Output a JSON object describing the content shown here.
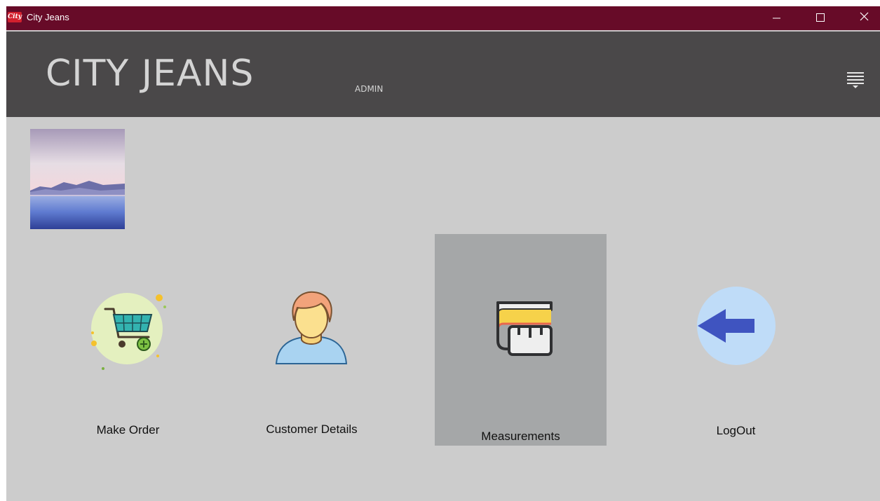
{
  "window": {
    "title": "City Jeans",
    "app_icon_text": "City",
    "controls": [
      "minimize-icon",
      "maximize-icon",
      "close-icon"
    ]
  },
  "header": {
    "brand": "CITY JEANS",
    "role": "ADMIN",
    "menu_icon": "hamburger-menu-icon"
  },
  "profile": {
    "avatar_icon": "landscape-image"
  },
  "tiles": [
    {
      "label": "Make Order",
      "icon": "shopping-cart-icon",
      "selected": false
    },
    {
      "label": "Customer Details",
      "icon": "user-icon",
      "selected": false
    },
    {
      "label": "Measurements",
      "icon": "measuring-tape-icon",
      "selected": true
    },
    {
      "label": "LogOut",
      "icon": "back-arrow-icon",
      "selected": false
    }
  ],
  "colors": {
    "titlebar": "#670b28",
    "header": "#4a4849",
    "background": "#cccccc",
    "selected_tile": "#a5a7a8",
    "brand_text": "#d4d4d4"
  }
}
